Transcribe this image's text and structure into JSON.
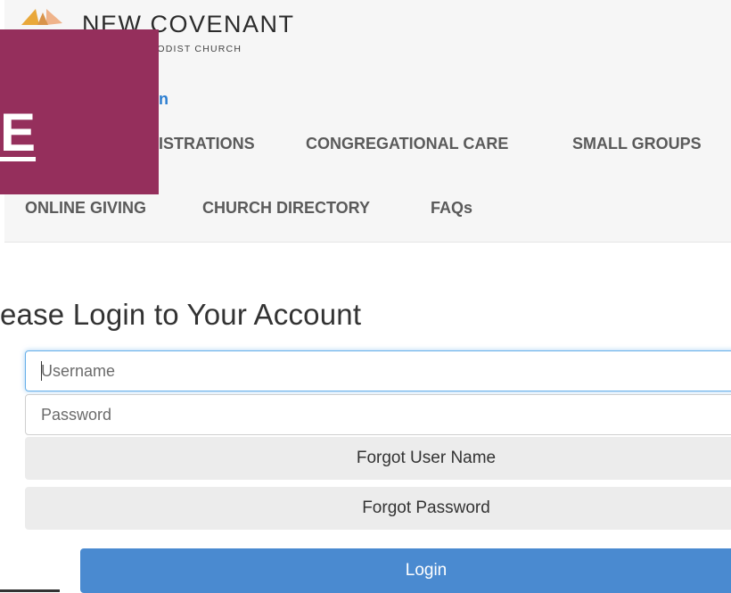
{
  "header": {
    "logo_name": "NEW COVENANT",
    "logo_subtitle": "THODIST CHURCH",
    "user_link": "n",
    "logo_colors": {
      "gold": "#e9a83a",
      "peach": "#efb38a"
    }
  },
  "overlay": {
    "letter": "E",
    "color": "#952f5c"
  },
  "nav": {
    "row1": [
      "ISTRATIONS",
      "CONGREGATIONAL CARE",
      "SMALL GROUPS"
    ],
    "row2": [
      "ONLINE GIVING",
      "CHURCH DIRECTORY",
      "FAQs"
    ]
  },
  "login": {
    "title": "ease Login to Your Account",
    "username_placeholder": "Username",
    "password_placeholder": "Password",
    "forgot_username": "Forgot User Name",
    "forgot_password": "Forgot Password",
    "submit": "Login",
    "accent": "#4a8ad0"
  }
}
